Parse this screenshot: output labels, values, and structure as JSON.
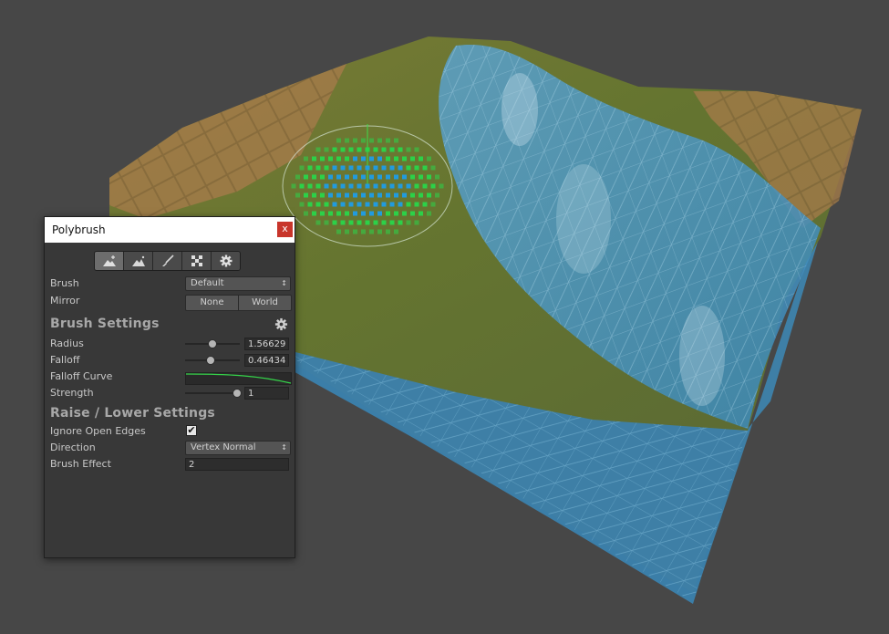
{
  "window": {
    "title": "Polybrush",
    "close_label": "x"
  },
  "toolbar": {
    "tools": [
      {
        "name": "raise-lower-tool",
        "active": true
      },
      {
        "name": "smooth-tool",
        "active": false
      },
      {
        "name": "paint-tool",
        "active": false
      },
      {
        "name": "texture-tool",
        "active": false
      },
      {
        "name": "settings-tool",
        "active": false
      }
    ]
  },
  "brush": {
    "label": "Brush",
    "value": "Default"
  },
  "mirror": {
    "label": "Mirror",
    "options": [
      "None",
      "World"
    ]
  },
  "brush_settings": {
    "heading": "Brush Settings",
    "radius": {
      "label": "Radius",
      "value": "1.56629",
      "slider_fraction": 0.5
    },
    "falloff": {
      "label": "Falloff",
      "value": "0.46434",
      "slider_fraction": 0.46
    },
    "falloff_curve": {
      "label": "Falloff Curve"
    },
    "strength": {
      "label": "Strength",
      "value": "1",
      "slider_fraction": 0.95
    }
  },
  "raise_lower": {
    "heading": "Raise / Lower Settings",
    "ignore_open_edges": {
      "label": "Ignore Open Edges",
      "checked": true,
      "mark": "✔"
    },
    "direction": {
      "label": "Direction",
      "value": "Vertex Normal"
    },
    "brush_effect": {
      "label": "Brush Effect",
      "value": "2"
    }
  },
  "colors": {
    "background": "#474747",
    "panel": "#383838",
    "accent_close": "#c8352b",
    "water": "#3b8bb8",
    "grass": "#6e7a3a",
    "brush_inner": "#1e9de8",
    "brush_outer": "#29d64a"
  }
}
